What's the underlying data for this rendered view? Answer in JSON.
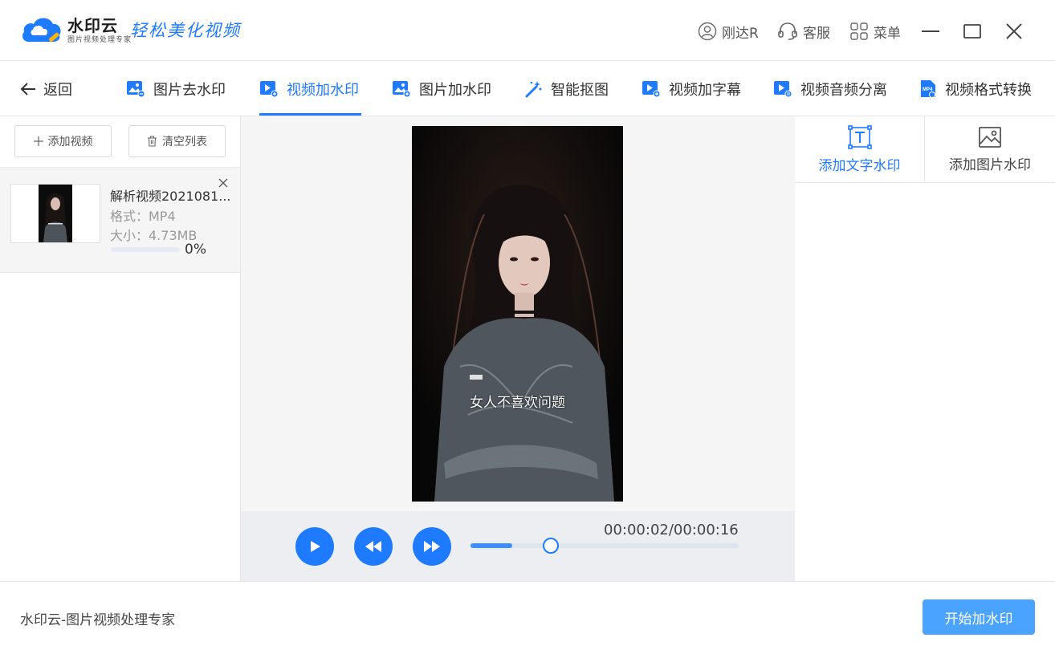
{
  "app": {
    "brand": "水印云",
    "brand_sub": "图片视频处理专家",
    "slogan": "轻松美化视频"
  },
  "titlebar": {
    "user_name": "刚达R",
    "service_label": "客服",
    "menu_label": "菜单"
  },
  "nav": {
    "back_label": "返回",
    "items": [
      {
        "label": "图片去水印",
        "icon": "image-remove-icon"
      },
      {
        "label": "视频加水印",
        "icon": "video-add-icon",
        "active": true
      },
      {
        "label": "图片加水印",
        "icon": "image-add-icon"
      },
      {
        "label": "智能抠图",
        "icon": "magic-wand-icon"
      },
      {
        "label": "视频加字幕",
        "icon": "video-subtitle-icon"
      },
      {
        "label": "视频音频分离",
        "icon": "video-audio-icon"
      },
      {
        "label": "视频格式转换",
        "icon": "mp4-file-icon"
      }
    ]
  },
  "left": {
    "add_video_label": "添加视频",
    "clear_list_label": "清空列表",
    "file": {
      "name": "解析视频2021081...",
      "format": "格式：MP4",
      "size": "大小：4.73MB",
      "progress_text": "0%",
      "progress": 0
    }
  },
  "preview": {
    "subtitle": "女人不喜欢问题",
    "time": "00:00:02/00:00:16",
    "position_seconds": 2,
    "duration_seconds": 16
  },
  "right": {
    "tab_text_label": "添加文字水印",
    "tab_image_label": "添加图片水印"
  },
  "footer": {
    "text": "水印云-图片视频处理专家",
    "start_label": "开始加水印"
  },
  "colors": {
    "accent": "#1e7bff",
    "start_button": "#4aa3ff"
  }
}
